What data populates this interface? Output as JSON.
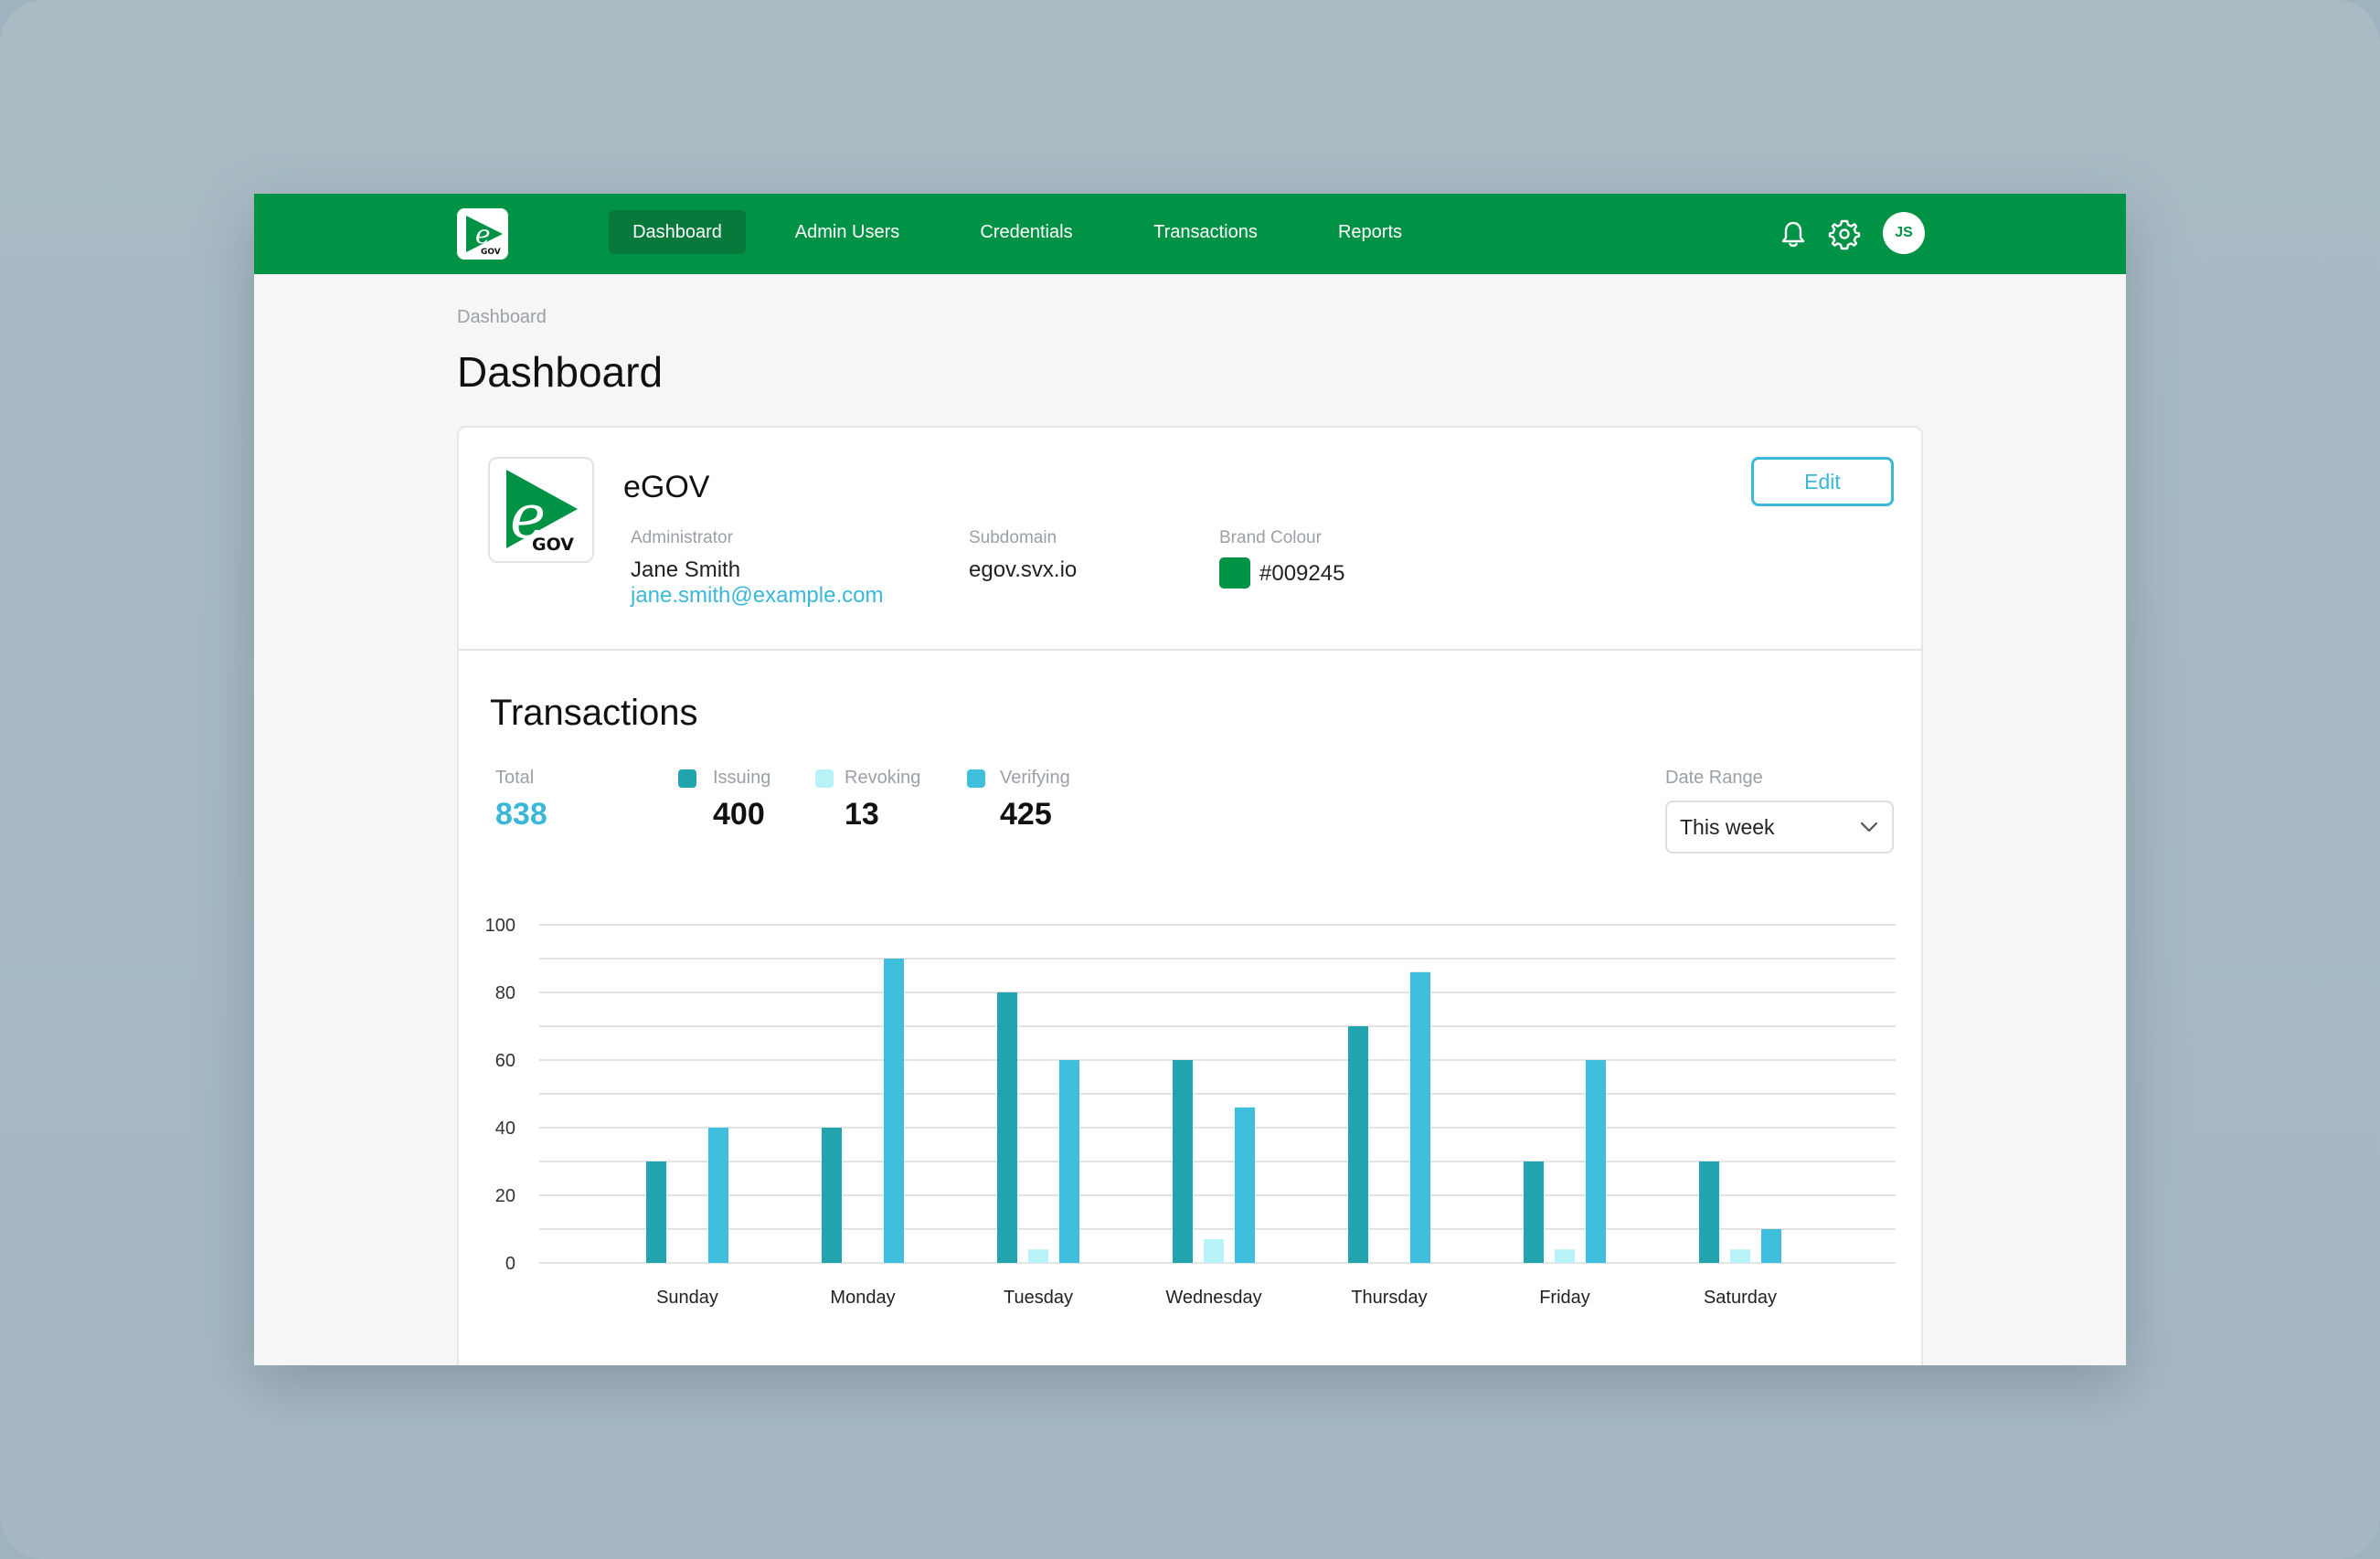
{
  "nav": {
    "items": [
      {
        "label": "Dashboard",
        "active": true
      },
      {
        "label": "Admin Users",
        "active": false
      },
      {
        "label": "Credentials",
        "active": false
      },
      {
        "label": "Transactions",
        "active": false
      },
      {
        "label": "Reports",
        "active": false
      }
    ],
    "icons": [
      "bell-icon",
      "gear-icon"
    ],
    "avatar_initials": "JS"
  },
  "breadcrumb": "Dashboard",
  "page_title": "Dashboard",
  "organization": {
    "name": "eGOV",
    "logo_text": "GOV",
    "administrator_label": "Administrator",
    "administrator_name": "Jane Smith",
    "administrator_email": "jane.smith@example.com",
    "subdomain_label": "Subdomain",
    "subdomain": "egov.svx.io",
    "brand_colour_label": "Brand Colour",
    "brand_colour": "#009245",
    "edit_label": "Edit"
  },
  "transactions": {
    "title": "Transactions",
    "total_label": "Total",
    "total": "838",
    "stats": [
      {
        "label": "Issuing",
        "value": "400",
        "color": "#21a4ad"
      },
      {
        "label": "Revoking",
        "value": "13",
        "color": "#b8f3f8"
      },
      {
        "label": "Verifying",
        "value": "425",
        "color": "#3fbfdc"
      }
    ],
    "date_range_label": "Date Range",
    "date_range_value": "This week"
  },
  "chart_data": {
    "type": "bar",
    "categories": [
      "Sunday",
      "Monday",
      "Tuesday",
      "Wednesday",
      "Thursday",
      "Friday",
      "Saturday"
    ],
    "series": [
      {
        "name": "Issuing",
        "color": "#21a4ad",
        "values": [
          30,
          40,
          80,
          60,
          70,
          30,
          30
        ]
      },
      {
        "name": "Revoking",
        "color": "#b8f3f8",
        "values": [
          0,
          0,
          4,
          7,
          0,
          4,
          4
        ]
      },
      {
        "name": "Verifying",
        "color": "#3fbfdc",
        "values": [
          40,
          90,
          60,
          46,
          86,
          60,
          10
        ]
      }
    ],
    "ylim": [
      0,
      100
    ],
    "yticks": [
      0,
      20,
      40,
      60,
      80,
      100
    ],
    "grid": true
  }
}
